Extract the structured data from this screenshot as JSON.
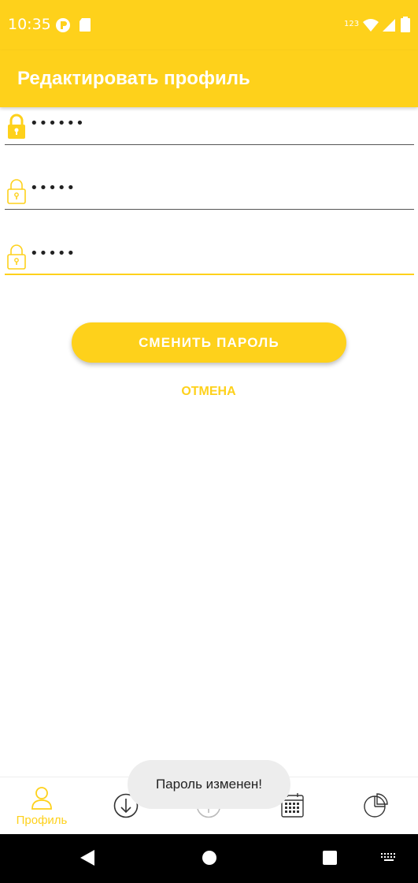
{
  "status_bar": {
    "time": "10:35",
    "network_label": "123",
    "icons": [
      "notification-icon",
      "sd-card-icon",
      "wifi-icon",
      "signal-icon",
      "battery-icon"
    ]
  },
  "app_bar": {
    "title": "Редактировать профиль"
  },
  "fields": [
    {
      "value": "••••••",
      "icon": "lock-filled-icon",
      "state": "normal"
    },
    {
      "value": "•••••",
      "icon": "lock-outline-icon",
      "state": "normal"
    },
    {
      "value": "•••••",
      "icon": "lock-outline-icon",
      "state": "focused"
    }
  ],
  "actions": {
    "change_password_label": "СМЕНИТЬ ПАРОЛЬ",
    "cancel_label": "ОТМЕНА"
  },
  "bottom_nav": {
    "items": [
      {
        "label": "Профиль",
        "icon": "profile-icon",
        "active": true
      },
      {
        "label": "",
        "icon": "download-icon",
        "active": false
      },
      {
        "label": "",
        "icon": "upload-icon",
        "active": false
      },
      {
        "label": "",
        "icon": "calendar-icon",
        "active": false
      },
      {
        "label": "",
        "icon": "pie-chart-icon",
        "active": false
      }
    ]
  },
  "toast": {
    "message": "Пароль изменен!"
  },
  "colors": {
    "accent": "#FED11B",
    "text": "#222222",
    "toast_bg": "#EDEDED"
  }
}
